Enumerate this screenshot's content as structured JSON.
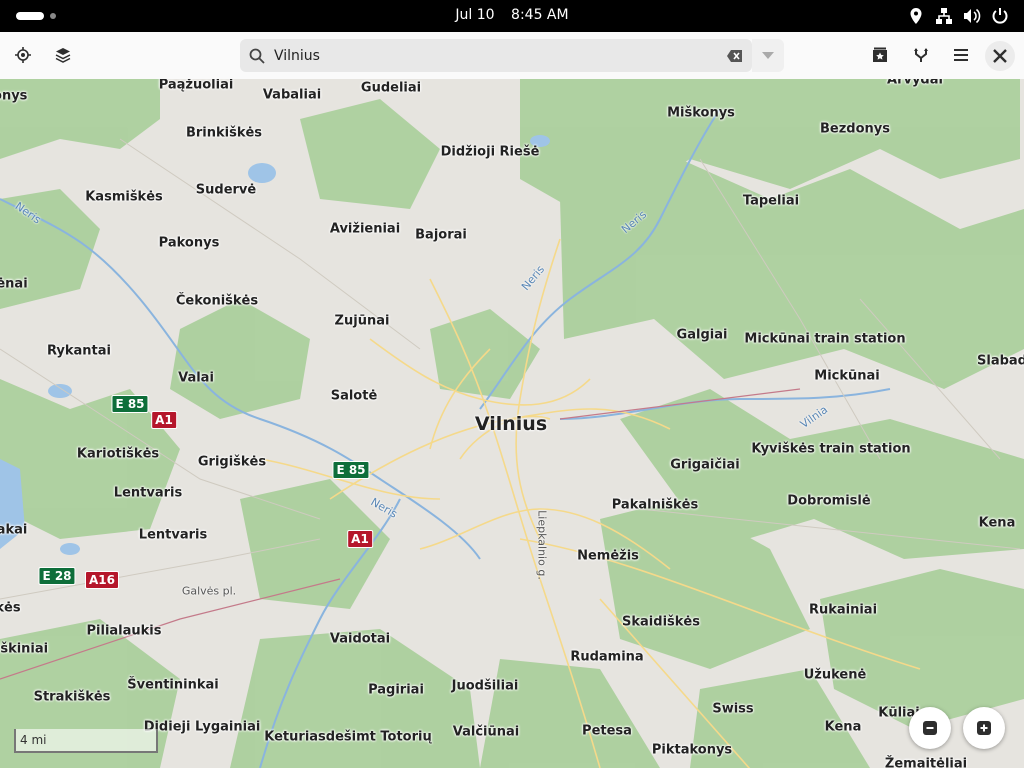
{
  "topbar": {
    "date": "Jul 10",
    "time": "8:45 AM",
    "tray_icons": [
      "location-icon",
      "network-icon",
      "volume-icon",
      "power-icon"
    ]
  },
  "header": {
    "search_value": "Vilnius",
    "buttons": [
      "locate-icon",
      "layers-icon",
      "favorites-icon",
      "route-icon",
      "menu-icon",
      "close-icon"
    ]
  },
  "map": {
    "city": "Vilnius",
    "places": [
      "Paąžuoliai",
      "Vabaliai",
      "Gudeliai",
      "Arvydai",
      "Miškonys",
      "Bezdonys",
      "Brinkiškės",
      "Didžioji Riešė",
      "ionys",
      "Kasmiškės",
      "Sudervė",
      "Tapeliai",
      "Avižieniai",
      "Bajorai",
      "Pakonys",
      "ėnai",
      "Čekoniškės",
      "Zujūnai",
      "Galgiai",
      "Mickūnai train station",
      "Slabad",
      "Rykantai",
      "Mickūnai",
      "Valai",
      "Salotė",
      "Kariotiškės",
      "Grigiškės",
      "Kyviškės train station",
      "Grigaičiai",
      "Lentvaris",
      "Pakalniškės",
      "Dobromislė",
      "akai",
      "Lentvaris",
      "Kena",
      "Nemėžis",
      "kės",
      "Pilialaukis",
      "Rukainiai",
      "Vaidotai",
      "Skaidiškės",
      "iškiniai",
      "Rudamina",
      "Šventininkai",
      "Užukenė",
      "Pagiriai",
      "Juodšiliai",
      "Strakiškės",
      "Swiss",
      "Kūliai",
      "Didieji Lygainiai",
      "Keturiasdešimt Totorių",
      "Valčiūnai",
      "Petesa",
      "Kena",
      "Piktakonys",
      "Žemaitėliai"
    ],
    "road_labels": [
      "Galvės pl.",
      "Liepkalnio g."
    ],
    "river_labels": [
      "Neris",
      "Neris",
      "Neris",
      "Neris",
      "Vilnia"
    ],
    "shields": [
      {
        "text": "E 85",
        "type": "e"
      },
      {
        "text": "A1",
        "type": "a"
      },
      {
        "text": "E 85",
        "type": "e"
      },
      {
        "text": "A1",
        "type": "a"
      },
      {
        "text": "E 28",
        "type": "e"
      },
      {
        "text": "A16",
        "type": "a"
      }
    ],
    "scale": "4 mi"
  },
  "colors": {
    "forest": "#a9ce9a",
    "land": "#e6e4df",
    "water": "#9fc4e7",
    "road": "#f5d98a",
    "e_shield": "#0e6e3a",
    "a_shield": "#b5162b"
  }
}
